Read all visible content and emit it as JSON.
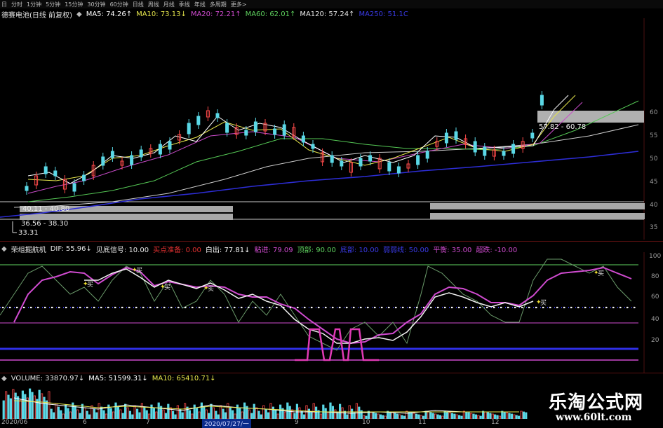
{
  "toolbar": {
    "items": [
      "日",
      "分时",
      "1分钟",
      "5分钟",
      "15分钟",
      "30分钟",
      "60分钟",
      "日线",
      "周线",
      "月线",
      "季线",
      "年线",
      "多周期",
      "更多>"
    ]
  },
  "main_legend": {
    "stock_name": "德赛电池(日线 前复权)",
    "ma5": "MA5: 74.26↑",
    "ma10": "MA10: 73.13↓",
    "ma20": "MA20: 72.21↑",
    "ma60": "MA60: 62.01↑",
    "ma120": "MA120: 57.24↑",
    "ma250": "MA250: 51.1C",
    "colors": {
      "ma5": "#ffffff",
      "ma10": "#e6e64c",
      "ma20": "#d04bd0",
      "ma60": "#5fd35f",
      "ma120": "#e6e6e6",
      "ma250": "#3636e0"
    }
  },
  "price_axis": {
    "ticks": [
      "60",
      "55",
      "50",
      "45",
      "40",
      "35"
    ]
  },
  "price_boxes": {
    "upper_label": "57.82 - 60.78",
    "left_top_label": "40.11 - 40.80",
    "left_bottom_label": "36.56 - 38.30",
    "low_label": "33.31"
  },
  "indicator_legend": {
    "name": "荣组掘航机",
    "dif": "DIF: 55.96↓",
    "see_bottom": "见底信号: 10.00",
    "buy_ready": "买点准备: 0.00",
    "white_out": "白出: 77.81↓",
    "sticky": "粘进: 79.09",
    "top": "顶部: 90.00",
    "bottom": "底部: 10.00",
    "weak": "弱弱线: 50.00",
    "balance": "平衡: 35.00",
    "dive": "超跌: -10.00"
  },
  "indicator_axis": {
    "ticks": [
      "100",
      "80",
      "60",
      "40",
      "20"
    ]
  },
  "buy_marks": [
    "买",
    "买",
    "买",
    "买",
    "买",
    "买"
  ],
  "volume_legend": {
    "name": "VOLUME: 33870.97↓",
    "ma5": "MA5: 51599.31↓",
    "ma10": "MA10: 65410.71↓"
  },
  "dates": [
    "2020/06",
    "6",
    "7",
    "2020/07/27/一",
    "9",
    "10",
    "11",
    "12"
  ],
  "watermark": {
    "title": "乐淘公式网",
    "url": "www.60lt.com"
  }
}
